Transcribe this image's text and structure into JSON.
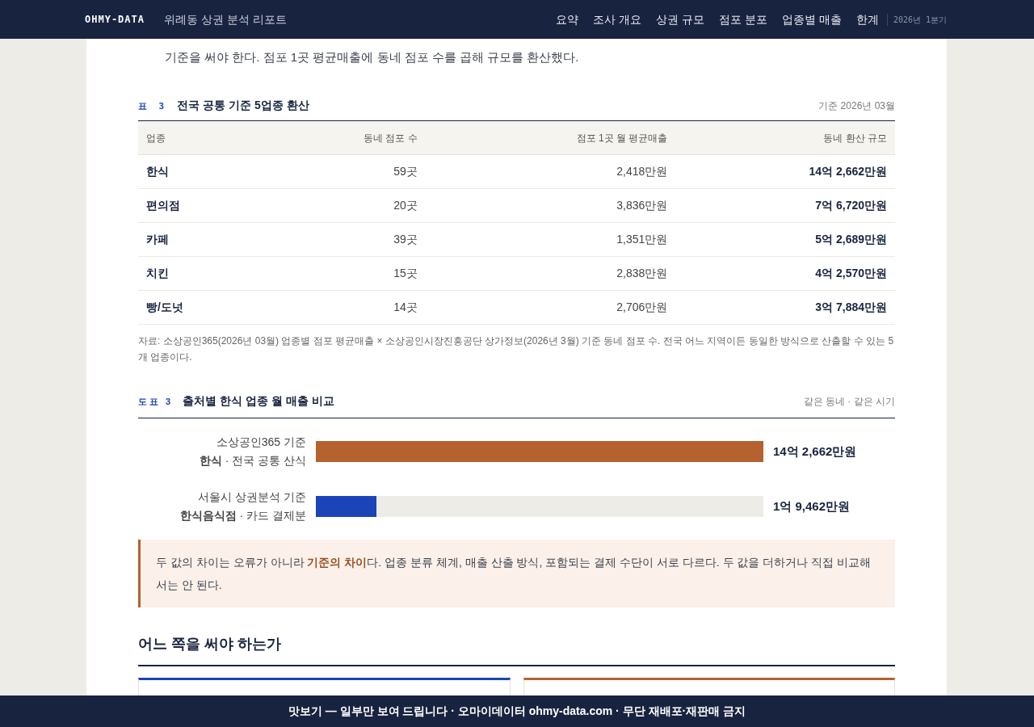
{
  "header": {
    "logo": "OHMY-DATA",
    "title": "위례동 상권 분석 리포트",
    "nav": [
      {
        "label": "요약",
        "selected": false
      },
      {
        "label": "조사 개요",
        "selected": false
      },
      {
        "label": "상권 규모",
        "selected": false
      },
      {
        "label": "점포 분포",
        "selected": false
      },
      {
        "label": "업종별 매출",
        "selected": false
      },
      {
        "label": "한계",
        "selected": false
      }
    ],
    "period": "2026년 1분기"
  },
  "intro": "기준을 써야 한다. 점포 1곳 평균매출에 동네 점포 수를 곱해 규모를 환산했다.",
  "table": {
    "tag": "표 3",
    "title": "전국 공통 기준 5업종 환산",
    "basis": "기준 2026년 03월",
    "columns": [
      "업종",
      "동네 점포 수",
      "점포 1곳 월 평균매출",
      "동네 환산 규모"
    ],
    "rows": [
      [
        "한식",
        "59곳",
        "2,418만원",
        "14억 2,662만원"
      ],
      [
        "편의점",
        "20곳",
        "3,836만원",
        "7억 6,720만원"
      ],
      [
        "카페",
        "39곳",
        "1,351만원",
        "5억 2,689만원"
      ],
      [
        "치킨",
        "15곳",
        "2,838만원",
        "4억 2,570만원"
      ],
      [
        "빵/도넛",
        "14곳",
        "2,706만원",
        "3억 7,884만원"
      ]
    ],
    "source": "자료: 소상공인365(2026년 03월) 업종별 점포 평균매출 × 소상공인시장진흥공단 상가정보(2026년 3월) 기준 동네 점포 수. 전국 어느 지역이든 동일한 방식으로 산출할 수 있는 5개 업종이다."
  },
  "figure": {
    "tag": "도표 3",
    "title": "출처별 한식 업종 월 매출 비교",
    "note": "같은 동네 · 같은 시기",
    "bars": [
      {
        "source": "소상공인365 기준",
        "label": "**한식** · 전국 공통 산식",
        "level": 1,
        "reading": "14억 2,662만원",
        "color": "#b5622e"
      },
      {
        "source": "서울시 상권분석 기준",
        "label": "**한식음식점** · 카드 결제분",
        "level": 0.136,
        "reading": "1억 9,462만원",
        "color": "#1b44b8"
      }
    ],
    "callout": "두 값의 차이는 오류가 아니라 **기준의 차이**다. 업종 분류 체계, 매출 산출 방식, 포함되는 결제 수단이 서로 다르다. 두 값을 더하거나 직접 비교해서는 안 된다."
  },
  "section": {
    "title": "어느 쪽을 써야 하는가",
    "cards": [
      {
        "color": "#1b44b8"
      },
      {
        "color": "#b5622e"
      }
    ]
  },
  "footer": "맛보기 — 일부만 보여 드립니다 · 오마이데이터 ohmy-data.com · 무단 재배포·재판매 금지"
}
